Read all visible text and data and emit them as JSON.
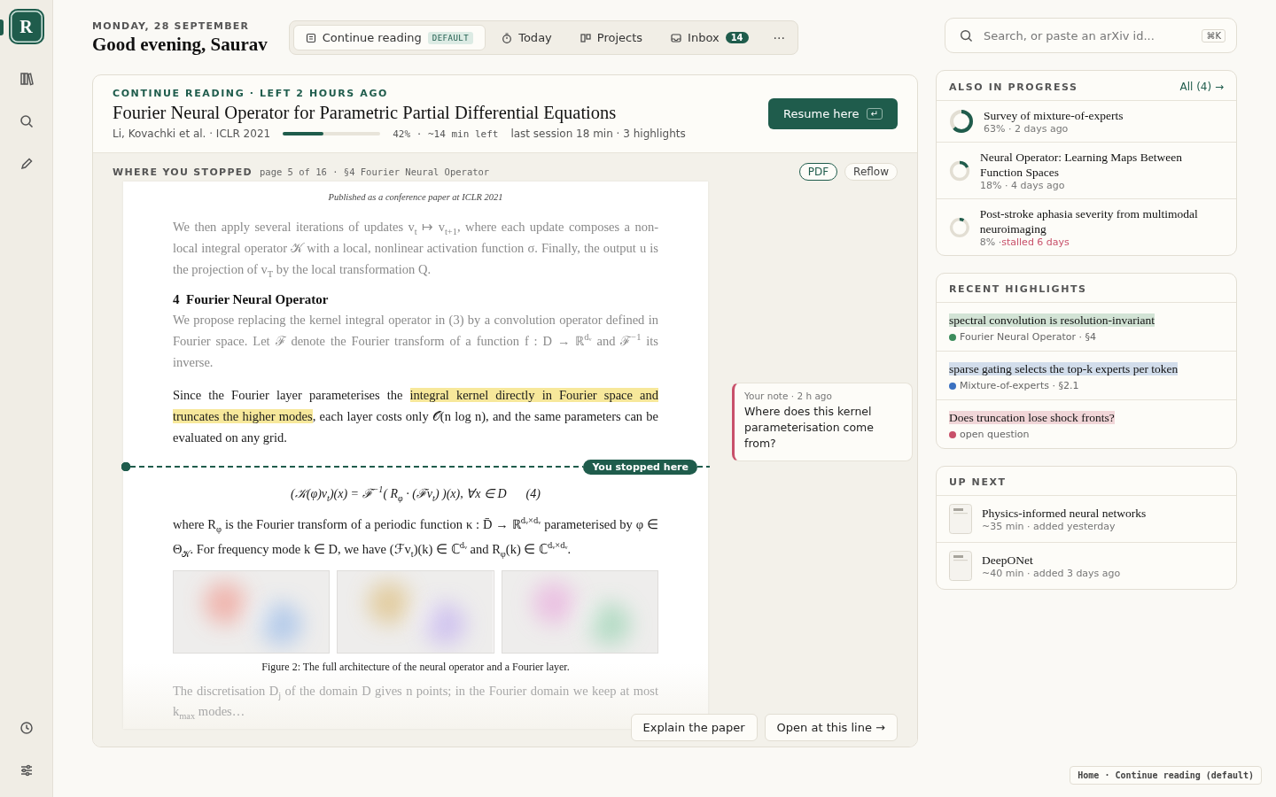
{
  "sidebar": {
    "logo": "R"
  },
  "header": {
    "date": "MONDAY, 28 SEPTEMBER",
    "greeting": "Good evening, Saurav"
  },
  "nav": {
    "tabs": [
      {
        "kind": "doc",
        "label": "Continue reading",
        "badge": "DEFAULT",
        "selected": true
      },
      {
        "kind": "timer",
        "label": "Today",
        "selected": false
      },
      {
        "kind": "board",
        "label": "Projects",
        "selected": false
      },
      {
        "kind": "inbox",
        "label": "Inbox",
        "count": "14",
        "selected": false
      }
    ],
    "more": "···"
  },
  "search": {
    "placeholder": "Search, or paste an arXiv id...",
    "shortcut": "⌘K"
  },
  "continue": {
    "eyebrow": "CONTINUE READING · LEFT 2 HOURS AGO",
    "title": "Fourier Neural Operator for Parametric Partial Differential Equations",
    "authors": "Li, Kovachki et al. · ICLR 2021",
    "level": 0.42,
    "reading": "42% · ~14 min left",
    "session": "last session 18 min · 3 highlights",
    "resume": {
      "label": "Resume here",
      "key": "↵"
    }
  },
  "stopped": {
    "label": "WHERE YOU STOPPED",
    "location": "page 5 of 16 · §4 Fourier Neural Operator",
    "views": [
      {
        "label": "PDF",
        "selected": true
      },
      {
        "label": "Reflow",
        "selected": false
      }
    ]
  },
  "document": {
    "blocks": [
      {
        "kind": "running_head",
        "text": "Published as a conference paper at ICLR 2021"
      },
      {
        "kind": "paragraph",
        "dimmed": true,
        "parts": [
          {
            "text": "We then apply several iterations of updates v$_{t}$ ↦ v$_{t+1}$, where each update composes a non-local integral operator 𝒦 with a local, nonlinear activation function σ. Finally, the output u is the projection of v$_{T}$ by the local transformation Q.",
            "highlighted": false
          }
        ]
      },
      {
        "kind": "heading",
        "text": "4  Fourier Neural Operator"
      },
      {
        "kind": "paragraph",
        "dimmed": true,
        "parts": [
          {
            "text": "We propose replacing the kernel integral operator in (3) by a convolution operator defined in Fourier space. Let ℱ denote the Fourier transform of a function f : D → ℝ$^{dᵥ}$ and ℱ$^{−1}$ its inverse.",
            "highlighted": false
          }
        ]
      },
      {
        "kind": "paragraph",
        "dimmed": false,
        "parts": [
          {
            "text": "Since the Fourier layer parameterises the ",
            "highlighted": false
          },
          {
            "text": "integral kernel directly in Fourier space and truncates the higher modes",
            "highlighted": true
          },
          {
            "text": ", each layer costs only 𝒪(n log n), and the same parameters can be evaluated on any grid.",
            "highlighted": false
          }
        ]
      },
      {
        "kind": "stop",
        "label": "You stopped here"
      },
      {
        "kind": "equation",
        "text": "(𝒦(φ)v$_{t}$)(x) = ℱ$^{−1}$( R$_{φ}$ · (ℱv$_{t}$) )(x),    ∀x ∈ D",
        "number": "(4)"
      },
      {
        "kind": "paragraph",
        "dimmed": false,
        "parts": [
          {
            "text": "where R$_{φ}$ is the Fourier transform of a periodic function κ : D̄ → ℝ$^{dᵥ×dᵥ}$ parameterised by φ ∈ Θ$_{𝒦}$. For frequency mode k ∈ D, we have (ℱv$_{t}$)(k) ∈ ℂ$^{dᵥ}$ and R$_{φ}$(k) ∈ ℂ$^{dᵥ×dᵥ}$.",
            "highlighted": false
          }
        ]
      },
      {
        "kind": "figure",
        "caption": "Figure 2: The full architecture of the neural operator and a Fourier layer."
      },
      {
        "kind": "paragraph",
        "dimmed": true,
        "parts": [
          {
            "text": "The discretisation D$_{j}$ of the domain D gives n points; in the Fourier domain we keep at most k$_{max}$ modes…",
            "highlighted": false
          }
        ]
      }
    ]
  },
  "note": {
    "meta": "Your note · 2 h ago",
    "text": "Where does this kernel parameterisation come from?"
  },
  "actions": [
    "Explain the paper",
    "Open at this line →"
  ],
  "in_progress": {
    "title": "ALSO IN PROGRESS",
    "link": "All (4) →",
    "items": [
      {
        "title": "Survey of mixture-of-experts",
        "level": 0.63,
        "meta": "63% · 2 days ago"
      },
      {
        "title": "Neural Operator: Learning Maps Between Function Spaces",
        "level": 0.18,
        "meta": "18% · 4 days ago"
      },
      {
        "title": "Post-stroke aphasia severity from multimodal neuroimaging",
        "level": 0.08,
        "meta": "8% ·",
        "alert": "stalled 6 days"
      }
    ]
  },
  "highlights": {
    "title": "RECENT HIGHLIGHTS",
    "items": [
      {
        "quote": "spectral convolution is resolution-invariant",
        "source": "Fourier Neural Operator · §4",
        "color": "#3c8c5c"
      },
      {
        "quote": "sparse gating selects the top-k experts per token",
        "source": "Mixture-of-experts · §2.1",
        "color": "#3a70c0"
      },
      {
        "quote": "Does truncation lose shock fronts?",
        "source": "open question",
        "color": "#c8506a"
      }
    ]
  },
  "up_next": {
    "title": "UP NEXT",
    "items": [
      {
        "title": "Physics-informed neural networks",
        "meta": "~35 min · added yesterday"
      },
      {
        "title": "DeepONet",
        "meta": "~40 min · added 3 days ago"
      }
    ]
  },
  "breadcrumb": "Home · Continue reading (default)"
}
